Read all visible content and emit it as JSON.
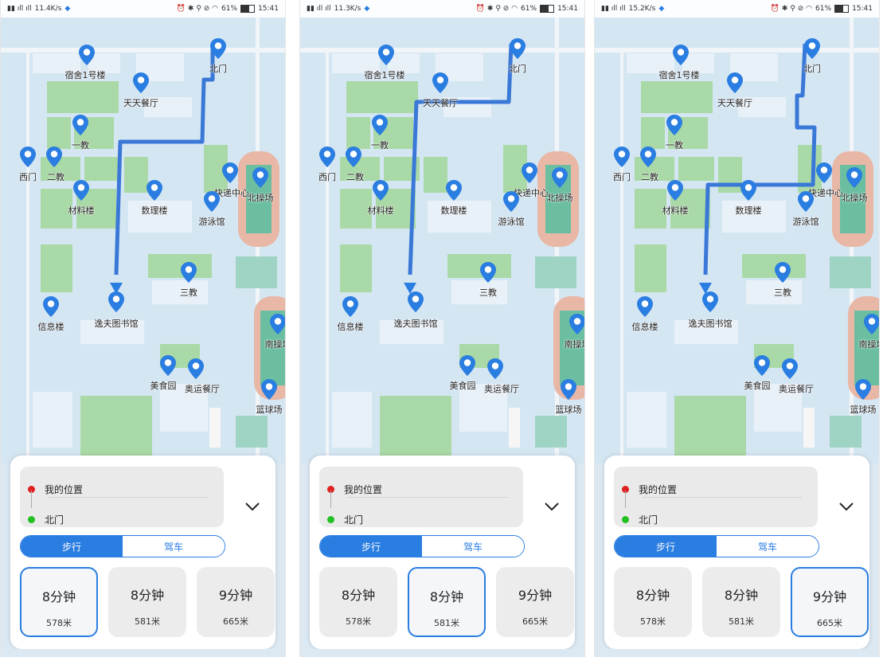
{
  "status_bar": {
    "left_text": [
      "11.4K/s",
      "11.3K/s",
      "15.2K/s"
    ],
    "battery": "61%",
    "time": "15:41"
  },
  "places": {
    "dorm": "宿舍1号楼",
    "north_gate": "北门",
    "tiantian": "天天餐厅",
    "yijiao": "一教",
    "west_gate": "西门",
    "erjiao": "二教",
    "cailiao": "材料楼",
    "shuli": "数理楼",
    "kuaidi": "快递中心",
    "beicao": "北操场",
    "youyong": "游泳馆",
    "sanjiao": "三教",
    "xinxi": "信息楼",
    "library": "逸夫图书馆",
    "nancao": "南操场",
    "meishi": "美食园",
    "aoyun": "奥运餐厅",
    "lanqiu": "篮球场"
  },
  "panel": {
    "origin": "我的位置",
    "destination": "北门",
    "modes": [
      "步行",
      "驾车"
    ],
    "routes": [
      {
        "time": "8分钟",
        "distance": "578米"
      },
      {
        "time": "8分钟",
        "distance": "581米"
      },
      {
        "time": "9分钟",
        "distance": "665米"
      }
    ]
  },
  "colors": {
    "accent": "#2a7de1",
    "origin_dot": "#e02020",
    "destination_dot": "#22c022",
    "route_line": "#3a78d8",
    "building_green": "#a9d9a6",
    "track": "#e8b7a6"
  },
  "screens": [
    {
      "selected_route": 0
    },
    {
      "selected_route": 1
    },
    {
      "selected_route": 2
    }
  ]
}
